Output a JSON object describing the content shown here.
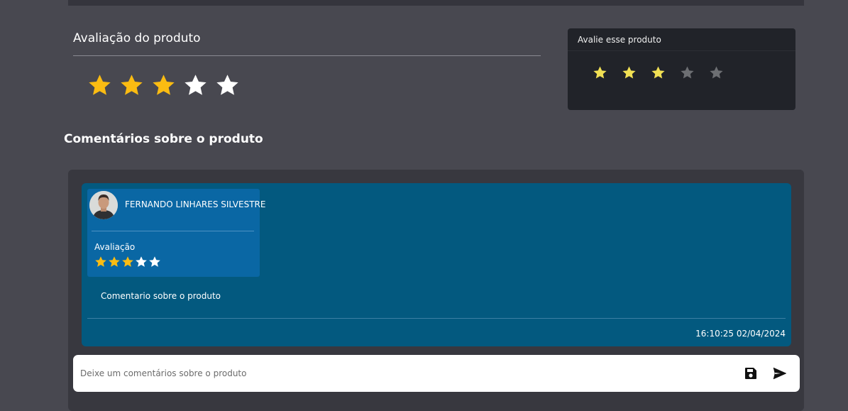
{
  "colors": {
    "star_filled": "#fbbc12",
    "star_empty": "#ffffff",
    "card_star_filled": "#f1e054",
    "card_star_empty": "#6d6f73",
    "comment_bg": "#03597f",
    "author_bg": "#0a67a4"
  },
  "product_rating": {
    "title": "Avaliação do produto",
    "value": 3,
    "max": 5
  },
  "rate_card": {
    "title": "Avalie esse produto",
    "value": 3,
    "max": 5
  },
  "comments": {
    "title": "Comentários sobre o produto",
    "items": [
      {
        "author": "FERNANDO LINHARES SILVESTRE",
        "rating_label": "Avaliação",
        "rating": 3,
        "max": 5,
        "text": "Comentario sobre o produto",
        "timestamp": "16:10:25 02/04/2024"
      }
    ]
  },
  "input": {
    "placeholder": "Deixe um comentários sobre o produto",
    "value": ""
  },
  "icons": {
    "save": "floppy-disk-icon",
    "send": "send-icon"
  }
}
